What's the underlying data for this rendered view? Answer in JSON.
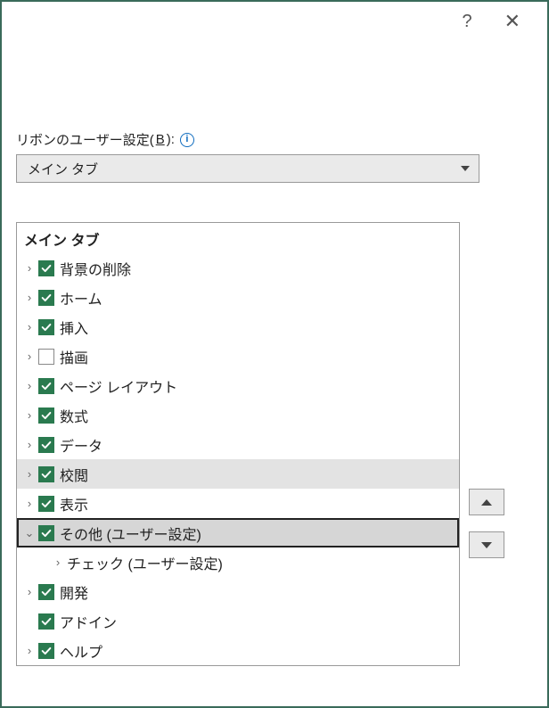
{
  "titlebar": {
    "help": "?",
    "close": "✕"
  },
  "field": {
    "label_prefix": "リボンのユーザー設定(",
    "label_accel": "B",
    "label_suffix": "):",
    "info": "i"
  },
  "dropdown": {
    "selected": "メイン タブ"
  },
  "tree": {
    "header": "メイン タブ",
    "items": [
      {
        "label": "背景の削除",
        "checked": true,
        "expanded": false,
        "child": false,
        "state": ""
      },
      {
        "label": "ホーム",
        "checked": true,
        "expanded": false,
        "child": false,
        "state": ""
      },
      {
        "label": "挿入",
        "checked": true,
        "expanded": false,
        "child": false,
        "state": ""
      },
      {
        "label": "描画",
        "checked": false,
        "expanded": false,
        "child": false,
        "state": ""
      },
      {
        "label": "ページ レイアウト",
        "checked": true,
        "expanded": false,
        "child": false,
        "state": ""
      },
      {
        "label": "数式",
        "checked": true,
        "expanded": false,
        "child": false,
        "state": ""
      },
      {
        "label": "データ",
        "checked": true,
        "expanded": false,
        "child": false,
        "state": ""
      },
      {
        "label": "校閲",
        "checked": true,
        "expanded": false,
        "child": false,
        "state": "highlight"
      },
      {
        "label": "表示",
        "checked": true,
        "expanded": false,
        "child": false,
        "state": ""
      },
      {
        "label": "その他 (ユーザー設定)",
        "checked": true,
        "expanded": true,
        "child": false,
        "state": "selected"
      },
      {
        "label": "チェック (ユーザー設定)",
        "checked": null,
        "expanded": false,
        "child": true,
        "state": ""
      },
      {
        "label": "開発",
        "checked": true,
        "expanded": false,
        "child": false,
        "state": ""
      },
      {
        "label": "アドイン",
        "checked": true,
        "expanded": null,
        "child": false,
        "state": ""
      },
      {
        "label": "ヘルプ",
        "checked": true,
        "expanded": false,
        "child": false,
        "state": ""
      }
    ]
  },
  "sidebuttons": {
    "up": "▲",
    "down": "▼"
  }
}
